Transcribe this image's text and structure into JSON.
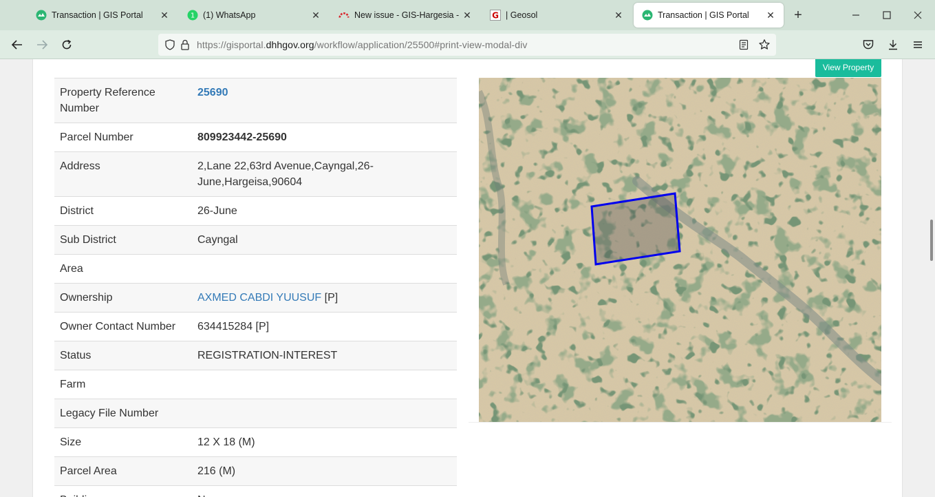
{
  "tabs": [
    {
      "title": "Transaction | GIS Portal",
      "active": false,
      "icon": "gis-portal-icon"
    },
    {
      "title": "(1) WhatsApp",
      "active": false,
      "icon": "whatsapp-icon",
      "badge": "1"
    },
    {
      "title": "New issue - GIS-Hargesia - Tea",
      "active": false,
      "icon": "devops-icon"
    },
    {
      "title": "| Geosol",
      "active": false,
      "icon": "geosol-icon",
      "icon_letter": "G"
    },
    {
      "title": "Transaction | GIS Portal",
      "active": true,
      "icon": "gis-portal-icon"
    }
  ],
  "toolbar": {
    "url_prefix": "https://gisportal.",
    "url_host": "dhhgov.org",
    "url_suffix": "/workflow/application/25500#print-view-modal-div"
  },
  "property": {
    "rows": [
      {
        "label": "Property Reference Number",
        "value": "25690",
        "style": "ref"
      },
      {
        "label": "Parcel Number",
        "value": "809923442-25690",
        "style": "bold"
      },
      {
        "label": "Address",
        "value": "2,Lane 22,63rd Avenue,Cayngal,26-June,Hargeisa,90604",
        "style": "plain"
      },
      {
        "label": "District",
        "value": "26-June",
        "style": "plain"
      },
      {
        "label": "Sub District",
        "value": "Cayngal",
        "style": "plain"
      },
      {
        "label": "Area",
        "value": "",
        "style": "plain"
      },
      {
        "label": "Ownership",
        "value": "AXMED CABDI YUUSUF",
        "suffix": " [P]",
        "style": "link"
      },
      {
        "label": "Owner Contact Number",
        "value": "634415284 [P]",
        "style": "plain"
      },
      {
        "label": "Status",
        "value": "REGISTRATION-INTEREST",
        "style": "plain"
      },
      {
        "label": "Farm",
        "value": "",
        "style": "plain"
      },
      {
        "label": "Legacy File Number",
        "value": "",
        "style": "plain"
      },
      {
        "label": "Size",
        "value": "12 X 18 (M)",
        "style": "plain"
      },
      {
        "label": "Parcel Area",
        "value": "216 (M)",
        "style": "plain"
      },
      {
        "label": "Building",
        "value": "No",
        "style": "plain"
      }
    ]
  },
  "map": {
    "view_button": "View Property",
    "parcel_outline_color": "#0000ee",
    "accent": "#1abc9c"
  }
}
